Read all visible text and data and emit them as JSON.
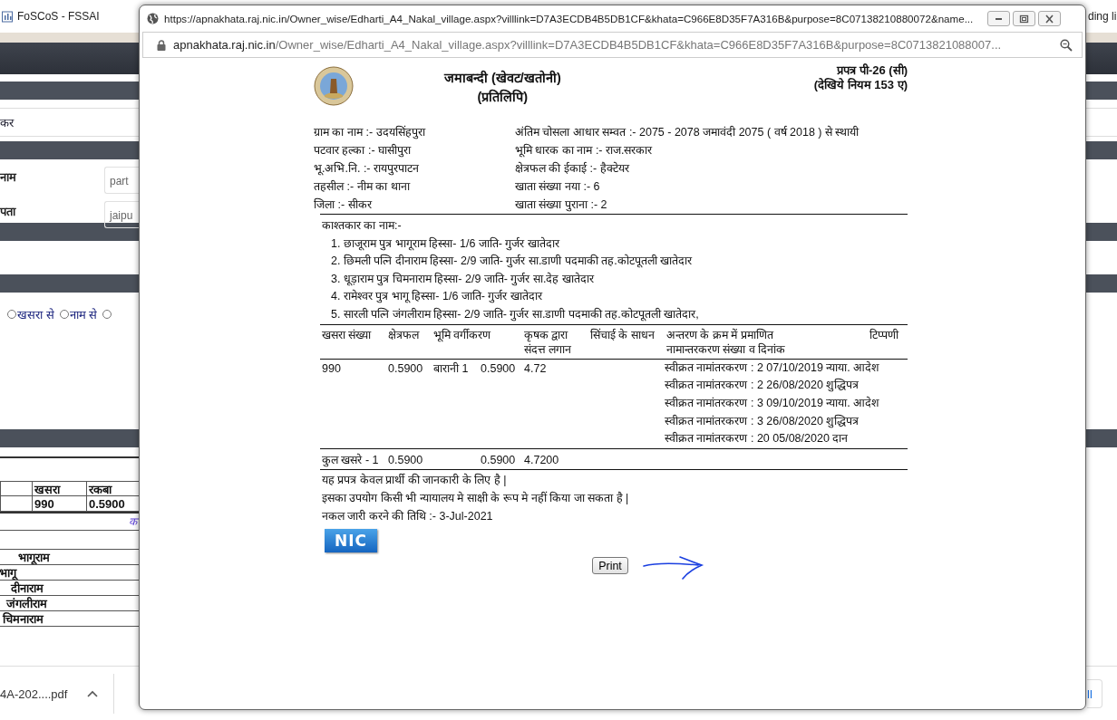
{
  "browser_tab": {
    "title": "FoSCoS - FSSAI",
    "partial_tab_text": "ding li"
  },
  "background_page": {
    "fragment_text": "कर",
    "fields": [
      {
        "label": "नाम",
        "value": "part"
      },
      {
        "label": "पता",
        "value": "jaipu"
      }
    ],
    "search_options": [
      {
        "label": "खसरा से",
        "selected": false
      },
      {
        "label": "नाम से",
        "selected": false
      },
      {
        "selected": false
      }
    ],
    "table": {
      "columns": [
        "खसरा",
        "रकबा"
      ],
      "rows": [
        [
          "990",
          "0.5900"
        ]
      ]
    },
    "link_fragment": "क",
    "owner_names": [
      "भागूराम",
      "भागू",
      "दीनाराम",
      "जंगलीराम",
      "चिमनाराम"
    ]
  },
  "downloads_bar": {
    "file": "4A-202....pdf",
    "show_all_fragment": "ll"
  },
  "popup": {
    "title_url": "https://apnakhata.raj.nic.in/Owner_wise/Edharti_A4_Nakal_village.aspx?villlink=D7A3ECDB4B5DB1CF&khata=C966E8D35F7A316B&purpose=8C07138210880072&name...",
    "address": {
      "domain": "apnakhata.raj.nic.in",
      "path": "/Owner_wise/Edharti_A4_Nakal_village.aspx?villlink=D7A3ECDB4B5DB1CF&khata=C966E8D35F7A316B&purpose=8C0713821088007..."
    },
    "document": {
      "title": [
        "जमाबन्दी (खेवट/खतोनी)",
        "(प्रतिलिपि)"
      ],
      "form_no": [
        "प्रपत्र पी-26 (सी)",
        "(देखिये नियम 153 ए)"
      ],
      "info_left": [
        "ग्राम का नाम :- उदयसिंहपुरा",
        "पटवार हल्का :- घासीपुरा",
        "भू.अभि.नि. :- रायपुरपाटन",
        "तहसील :- नीम का थाना",
        "जिला :- सीकर"
      ],
      "info_right": [
        "अंतिम चोसला आधार सम्वत :- 2075 - 2078 जमावंदी 2075 ( वर्ष 2018 ) से स्थायी",
        "भूमि धारक का नाम :- राज.सरकार",
        "क्षेत्रफल की ईकाई :- हैक्टेयर",
        "खाता संख्या नया :- 6",
        "खाता संख्या पुराना :- 2"
      ],
      "cultivator_heading": "काश्तकार का नाम:-",
      "cultivators": [
        "1. छाजूराम पुत्र भागूराम हिस्सा- 1/6 जाति- गुर्जर खातेदार",
        "2. छिमली पत्नि दीनाराम हिस्सा- 2/9 जाति- गुर्जर सा.डाणी पदमाकी तह.कोटपूतली खातेदार",
        "3. धूड़ाराम पुत्र चिमनाराम हिस्सा- 2/9 जाति- गुर्जर सा.देह खातेदार",
        "4. रामेश्वर पुत्र भागू हिस्सा- 1/6 जाति- गुर्जर खातेदार",
        "5. सारली पत्नि जंगलीराम हिस्सा- 2/9 जाति- गुर्जर सा.डाणी पदमाकी तह.कोटपूतली खातेदार,"
      ],
      "columns": [
        "खसरा संख्या",
        "क्षेत्रफल",
        "भूमि वर्गीकरण",
        "कृषक द्वारा संदत्त लगान",
        "सिंचाई के साधन",
        "अन्तरण के क्रम में प्रमाणित नामान्तरकरण संख्या व दिनांक",
        "टिप्पणी"
      ],
      "rows": [
        {
          "khasra": "990",
          "area": "0.5900",
          "classification": "बारानी 1",
          "class_area": "0.5900",
          "rent": "4.72",
          "transfers": [
            "स्वीक्रत नामांतरकरण : 2 07/10/2019 न्याया. आदेश",
            "स्वीक्रत नामांतरकरण : 2 26/08/2020 शुद्धिपत्र",
            "स्वीक्रत नामांतरकरण : 3 09/10/2019 न्याया. आदेश",
            "स्वीक्रत नामांतरकरण : 3 26/08/2020 शुद्धिपत्र",
            "स्वीक्रत नामांतरकरण : 20 05/08/2020 दान"
          ]
        }
      ],
      "totals": {
        "label": "कुल खसरे - 1",
        "area": "0.5900",
        "class_area": "0.5900",
        "rent": "4.7200"
      },
      "notes": [
        "यह प्रपत्र केवल प्रार्थी की जानकारी के लिए है |",
        "इसका उपयोग किसी भी न्यायालय मे साक्षी के रूप मे नहीं किया जा सकता है |",
        "नकल जारी करने की तिथि :- 3-Jul-2021"
      ],
      "logo": "NIC",
      "print_button": "Print"
    }
  }
}
